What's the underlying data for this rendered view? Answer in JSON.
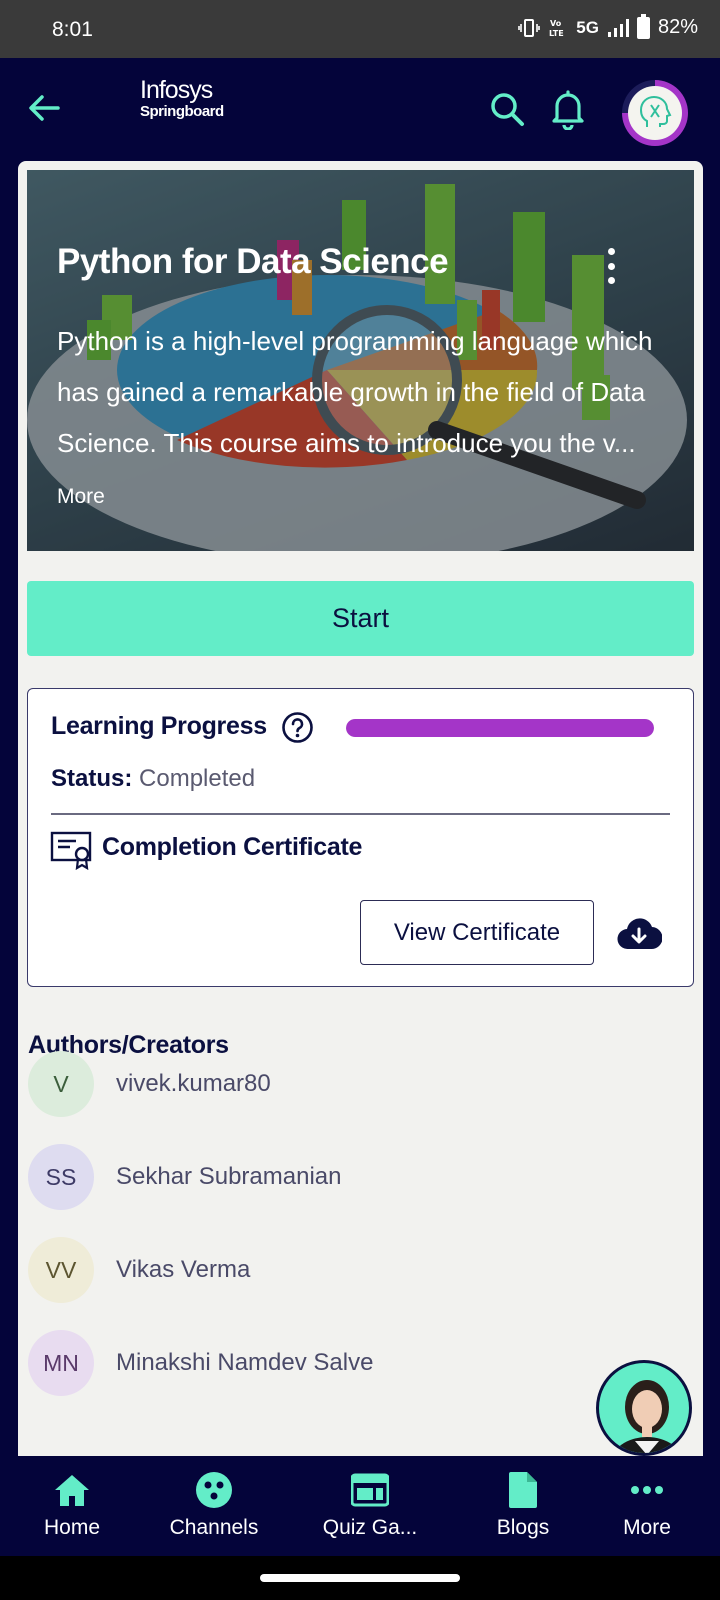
{
  "status_bar": {
    "time": "8:01",
    "network_label": "5G",
    "battery": "82%"
  },
  "header": {
    "logo_line1": "Infosys",
    "logo_line2": "Springboard",
    "icons": [
      "arrow-left-icon",
      "search-icon",
      "bell-icon",
      "profile-avatar"
    ],
    "accent_color": "#63edc8",
    "background_color": "#04043a"
  },
  "course": {
    "title": "Python for Data Science",
    "description": "Python is a high-level programming language which has gained a remarkable growth in the field of Data Science. This course aims to introduce you the v...",
    "more_label": "More",
    "start_label": "Start"
  },
  "progress": {
    "label": "Learning Progress",
    "percent": 100,
    "bar_color": "#a435c8",
    "status_key": "Status:",
    "status_value": "Completed",
    "certificate_label": "Completion Certificate",
    "view_certificate_label": "View Certificate"
  },
  "authors": {
    "heading": "Authors/Creators",
    "items": [
      {
        "initials": "V",
        "name": "vivek.kumar80",
        "color": "#dcecdc",
        "text_color": "#3b5e3b"
      },
      {
        "initials": "SS",
        "name": "Sekhar Subramanian",
        "color": "#dedcf0",
        "text_color": "#3d3a66"
      },
      {
        "initials": "VV",
        "name": "Vikas Verma",
        "color": "#efecd8",
        "text_color": "#5c5530"
      },
      {
        "initials": "MN",
        "name": "Minakshi Namdev Salve",
        "color": "#e8dcf0",
        "text_color": "#5a3a6a"
      }
    ]
  },
  "nav": {
    "items": [
      {
        "label": "Home",
        "icon": "home-icon"
      },
      {
        "label": "Channels",
        "icon": "channels-icon"
      },
      {
        "label": "Quiz Ga...",
        "icon": "quiz-icon"
      },
      {
        "label": "Blogs",
        "icon": "blogs-icon"
      },
      {
        "label": "More",
        "icon": "more-icon"
      }
    ]
  }
}
